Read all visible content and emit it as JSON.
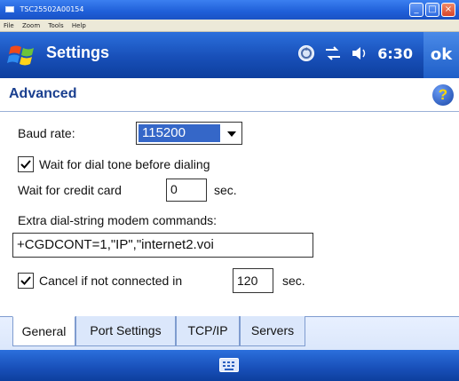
{
  "window": {
    "title": "TSC25502A00154"
  },
  "menu": [
    "File",
    "Zoom",
    "Tools",
    "Help"
  ],
  "titlebar": {
    "title": "Settings",
    "time": "6:30",
    "ok_label": "ok"
  },
  "section": {
    "title": "Advanced"
  },
  "form": {
    "baud_label": "Baud rate:",
    "baud_value": "115200",
    "dial_tone_label": "Wait for dial tone before dialing",
    "dial_tone_checked": true,
    "credit_label": "Wait for credit card",
    "credit_value": "0",
    "credit_unit": "sec.",
    "extra_label": "Extra dial-string modem commands:",
    "extra_value": "+CGDCONT=1,\"IP\",\"internet2.voi",
    "cancel_label": "Cancel if not connected in",
    "cancel_checked": true,
    "cancel_value": "120",
    "cancel_unit": "sec."
  },
  "tabs": [
    {
      "label": "General",
      "active": true
    },
    {
      "label": "Port Settings",
      "active": false
    },
    {
      "label": "TCP/IP",
      "active": false
    },
    {
      "label": "Servers",
      "active": false
    }
  ],
  "icons": {
    "start": "windows-flag-icon",
    "connectivity": "sync-icon",
    "network": "network-arrows-icon",
    "volume": "speaker-icon",
    "help": "help-icon",
    "keyboard": "keyboard-icon"
  },
  "colors": {
    "titlebar": "#184fb8",
    "selection": "#3567c8",
    "section_title": "#1a3f8f"
  }
}
